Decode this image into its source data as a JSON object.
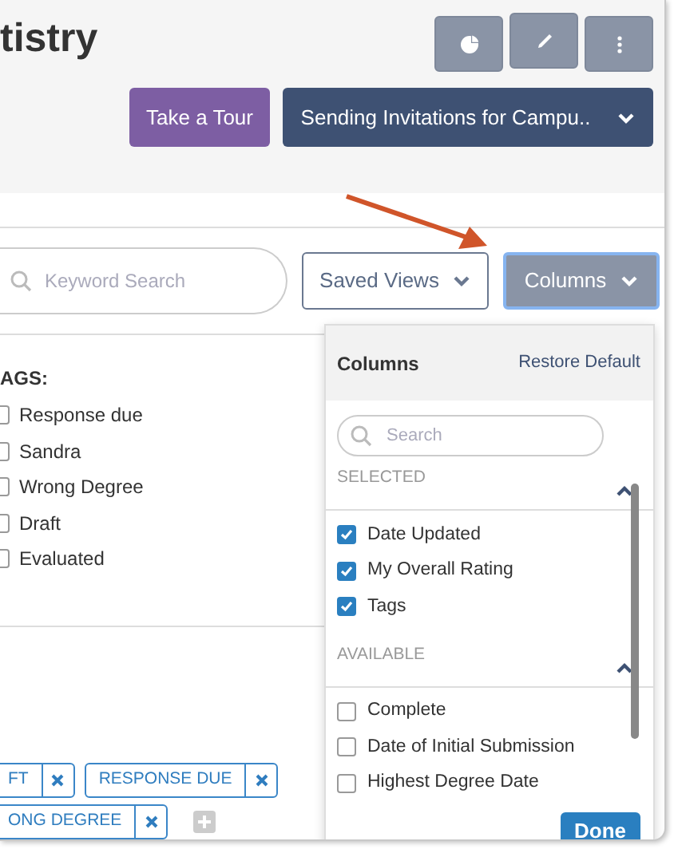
{
  "page_title": "tistry",
  "header_buttons": [
    {
      "kind": "chart"
    },
    {
      "kind": "edit"
    },
    {
      "kind": "more"
    }
  ],
  "tour_button": "Take a Tour",
  "campaign_button": {
    "label": "Sending Invitations for Campu..",
    "expanded": false
  },
  "search": {
    "placeholder": "Keyword Search"
  },
  "saved_views_button": {
    "label": "Saved Views",
    "expanded": false
  },
  "columns_button": {
    "label": "Columns",
    "expanded": true
  },
  "tags": {
    "heading": "AGS:",
    "items": [
      {
        "label": "Response due",
        "checked": false
      },
      {
        "label": "Sandra",
        "checked": false
      },
      {
        "label": "Wrong Degree",
        "checked": false
      },
      {
        "label": "Draft",
        "checked": false
      },
      {
        "label": "Evaluated",
        "checked": false
      }
    ]
  },
  "filter_chip_rows": [
    {
      "chips": [
        {
          "label": "FT"
        },
        {
          "label": "RESPONSE DUE"
        }
      ]
    },
    {
      "chips": [
        {
          "label": "ONG DEGREE"
        }
      ]
    }
  ],
  "columns_menu": {
    "title": "Columns",
    "restore_link": "Restore Default",
    "search": {
      "placeholder": "Search"
    },
    "sections": [
      {
        "heading": "SELECTED",
        "expanded": true,
        "items": [
          {
            "label": "Date Updated",
            "checked": true
          },
          {
            "label": "My Overall Rating",
            "checked": true
          },
          {
            "label": "Tags",
            "checked": true
          }
        ]
      },
      {
        "heading": "AVAILABLE",
        "expanded": true,
        "items": [
          {
            "label": "Complete",
            "checked": false
          },
          {
            "label": "Date of Initial Submission",
            "checked": false
          },
          {
            "label": "Highest Degree Date",
            "checked": false
          }
        ]
      }
    ],
    "done_button": "Done"
  }
}
